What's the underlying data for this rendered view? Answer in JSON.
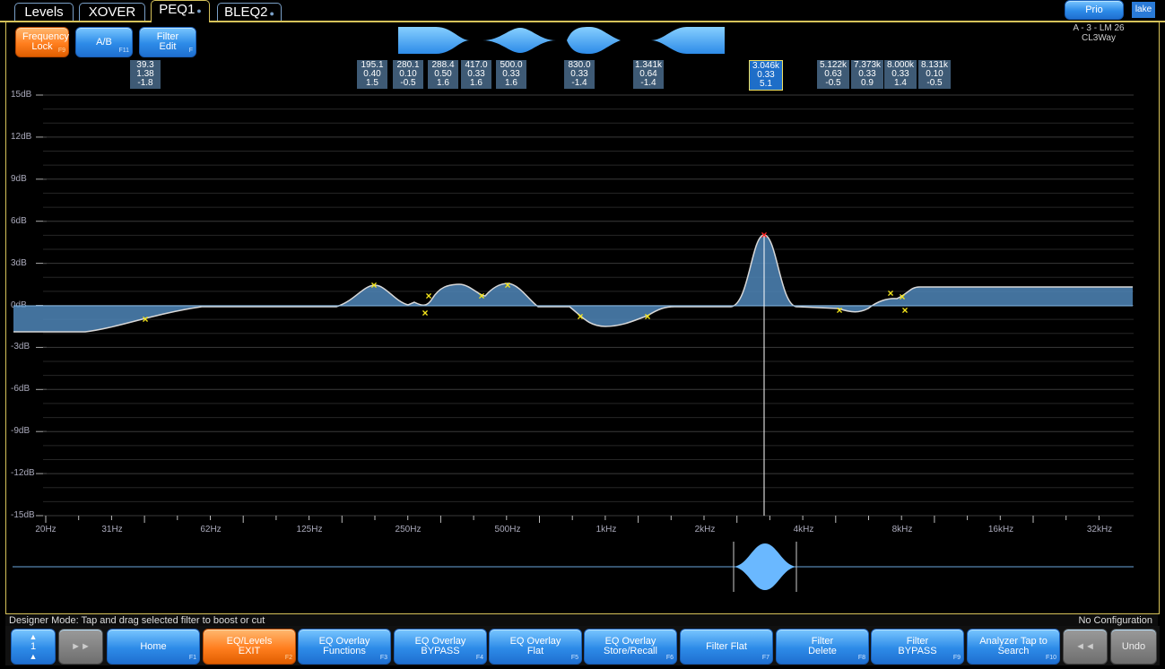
{
  "tabs": [
    {
      "label": "Levels"
    },
    {
      "label": "XOVER"
    },
    {
      "label": "PEQ1"
    },
    {
      "label": "BLEQ2"
    }
  ],
  "prio_label": "Prio",
  "logo_text": "lake",
  "device": {
    "line1": "A - 3 - LM 26",
    "line2": "CL3Way"
  },
  "top_buttons": {
    "frequency_lock": "Frequency Lock",
    "frequency_lock_fkey": "F9",
    "ab": "A/B",
    "ab_fkey": "F11",
    "filter_edit": "Filter Edit",
    "filter_edit_fkey": "F"
  },
  "filter_labels": [
    {
      "freq": "39.3",
      "q": "1.38",
      "gain": "-1.8"
    },
    {
      "freq": "195.1",
      "q": "0.40",
      "gain": "1.5"
    },
    {
      "freq": "280.1",
      "q": "0.10",
      "gain": "-0.5"
    },
    {
      "freq": "288.4",
      "q": "0.50",
      "gain": "1.6"
    },
    {
      "freq": "417.0",
      "q": "0.33",
      "gain": "1.6"
    },
    {
      "freq": "500.0",
      "q": "0.33",
      "gain": "1.6"
    },
    {
      "freq": "830.0",
      "q": "0.33",
      "gain": "-1.4"
    },
    {
      "freq": "1.341k",
      "q": "0.64",
      "gain": "-1.4"
    },
    {
      "freq": "3.046k",
      "q": "0.33",
      "gain": "5.1"
    },
    {
      "freq": "5.122k",
      "q": "0.63",
      "gain": "-0.5"
    },
    {
      "freq": "7.373k",
      "q": "0.33",
      "gain": "0.9"
    },
    {
      "freq": "8.000k",
      "q": "0.33",
      "gain": "1.4"
    },
    {
      "freq": "8.131k",
      "q": "0.10",
      "gain": "-0.5"
    }
  ],
  "y_axis_labels": [
    "15dB",
    "12dB",
    "9dB",
    "6dB",
    "3dB",
    "0dB",
    "-3dB",
    "-6dB",
    "-9dB",
    "-12dB",
    "-15dB"
  ],
  "x_axis_labels": [
    "20Hz",
    "31Hz",
    "62Hz",
    "125Hz",
    "250Hz",
    "500Hz",
    "1kHz",
    "2kHz",
    "4kHz",
    "8kHz",
    "16kHz",
    "32kHz"
  ],
  "colors": {
    "accent_gold": "#d6c25a",
    "curve_fill": "#4f86b8",
    "button_blue": "#2d8be8",
    "button_orange": "#ff7e1e",
    "marker_yellow": "#f4e51c",
    "marker_red": "#ff2020"
  },
  "status": {
    "left": "Designer Mode: Tap and drag selected filter to boost or cut",
    "right": "No Configuration"
  },
  "toolbar": {
    "page_num": "1",
    "home": "Home",
    "home_fkey": "F1",
    "eq_levels": "EQ/Levels EXIT",
    "eq_levels_fkey": "F2",
    "eq_overlay_functions": "EQ Overlay Functions",
    "eq_overlay_functions_fkey": "F3",
    "eq_overlay_bypass": "EQ Overlay BYPASS",
    "eq_overlay_bypass_fkey": "F4",
    "eq_overlay_flat": "EQ Overlay Flat",
    "eq_overlay_flat_fkey": "F5",
    "eq_overlay_store": "EQ Overlay Store/Recall",
    "eq_overlay_store_fkey": "F6",
    "filter_flat": "Filter Flat",
    "filter_flat_fkey": "F7",
    "filter_delete": "Filter Delete",
    "filter_delete_fkey": "F8",
    "filter_bypass": "Filter BYPASS",
    "filter_bypass_fkey": "F9",
    "analyzer": "Analyzer Tap to Search",
    "analyzer_fkey": "F10",
    "undo": "Undo"
  }
}
